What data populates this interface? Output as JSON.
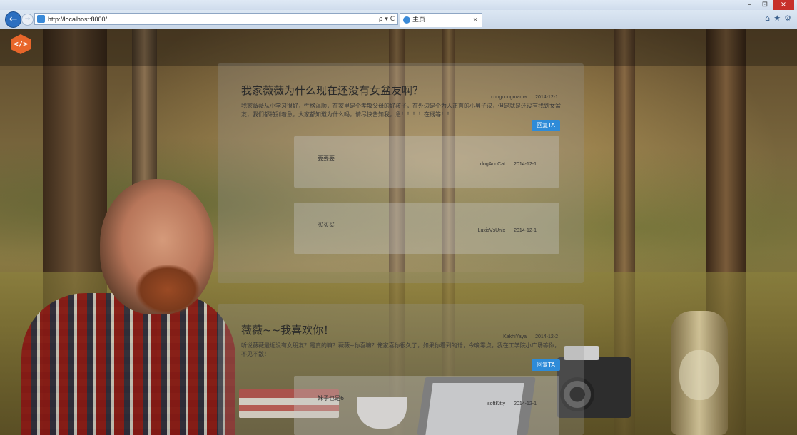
{
  "browser": {
    "url": "http://localhost:8000/",
    "address_tools": "ρ ▾ C",
    "tab_title": "主页",
    "tab_close": "×",
    "window_controls": [
      "–",
      "⊡",
      "×"
    ],
    "right_tools": [
      "⌂",
      "★",
      "⚙"
    ]
  },
  "site": {
    "logo_glyph": "</>",
    "accent_color": "#e8662a",
    "button_color": "#2e8bd8"
  },
  "posts": [
    {
      "title": "我家薇薇为什么现在还没有女盆友啊？",
      "author": "congcongmama",
      "date": "2014-12-1",
      "body": "我家薇薇从小学习很好，性格温顺，在家里是个孝敬父母的好孩子，在外边是个为人正直的小男子汉，但是就是还没有找到女盆友，我们都特别着急，大家都知道为什么吗，请尽快告知我，急！！！！在线等！！",
      "reply_label": "回复TA",
      "replies": [
        {
          "text": "要要要",
          "author": "dogAndCat",
          "date": "2014-12-1"
        },
        {
          "text": "买买买",
          "author": "LuxisVsUnix",
          "date": "2014-12-1"
        }
      ]
    },
    {
      "title": "薇薇~~我喜欢你！",
      "author": "KakhiYaya",
      "date": "2014-12-2",
      "body": "听说薇薇最近没有女朋友？是真的嘛？薇薇~你喜嘛？俺家喜你很久了，如果你看到的话，今晚零点，我在工学院小广场等你，不见不散！",
      "reply_label": "回复TA",
      "replies": [
        {
          "text": "妹子也是6",
          "author": "softKitty",
          "date": "2014-12-1"
        }
      ]
    }
  ]
}
